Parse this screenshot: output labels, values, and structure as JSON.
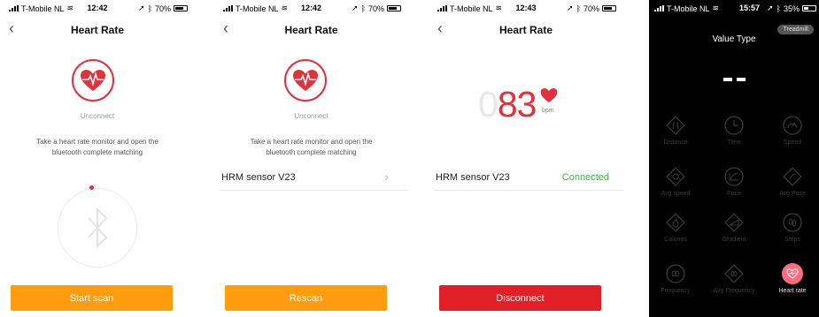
{
  "screens": [
    {
      "status": {
        "carrier": "T-Mobile NL",
        "time": "12:42",
        "battery": "70%"
      },
      "title": "Heart Rate",
      "state_label": "Unconnect",
      "instruction_line1": "Take a heart rate monitor and open the",
      "instruction_line2": "bluetooth complete matching",
      "button_label": "Start scan"
    },
    {
      "status": {
        "carrier": "T-Mobile NL",
        "time": "12:42",
        "battery": "70%"
      },
      "title": "Heart Rate",
      "state_label": "Unconnect",
      "instruction_line1": "Take a heart rate monitor and open the",
      "instruction_line2": "bluetooth complete matching",
      "device_name": "HRM sensor V23",
      "button_label": "Rescan"
    },
    {
      "status": {
        "carrier": "T-Mobile NL",
        "time": "12:43",
        "battery": "70%"
      },
      "title": "Heart Rate",
      "bpm_leading": "0",
      "bpm_value": "83",
      "bpm_unit": "bpm",
      "device_name": "HRM sensor V23",
      "device_status": "Connected",
      "button_label": "Disconnect"
    },
    {
      "status": {
        "carrier": "T-Mobile NL",
        "time": "15:57",
        "battery": "35%"
      },
      "title": "Value Type",
      "mode_button": "Treadmill",
      "items": [
        {
          "label": "Distance",
          "icon": "distance-icon"
        },
        {
          "label": "Time",
          "icon": "clock-icon"
        },
        {
          "label": "Speed",
          "icon": "speedometer-icon"
        },
        {
          "label": "Avg speed",
          "icon": "avg-speed-icon"
        },
        {
          "label": "Pace",
          "icon": "pace-icon"
        },
        {
          "label": "Avg Pace",
          "icon": "avg-pace-icon"
        },
        {
          "label": "Calories",
          "icon": "flame-icon"
        },
        {
          "label": "Gradient",
          "icon": "gradient-icon"
        },
        {
          "label": "Steps",
          "icon": "footsteps-icon"
        },
        {
          "label": "Frequency",
          "icon": "frequency-icon"
        },
        {
          "label": "Avg Frequency",
          "icon": "avg-frequency-icon"
        },
        {
          "label": "Heart rate",
          "icon": "heart-rate-icon",
          "selected": true
        }
      ]
    }
  ],
  "colors": {
    "accent_red": "#e0323c",
    "orange_button": "#ff9c10",
    "red_button": "#e11f26",
    "connected_green": "#3ab54a",
    "selected_pink": "#ff6b7e"
  }
}
